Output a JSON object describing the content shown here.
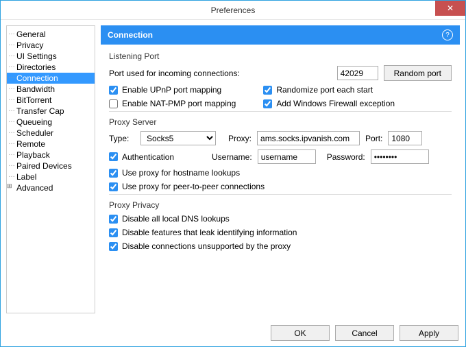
{
  "window": {
    "title": "Preferences"
  },
  "tree": {
    "items": [
      "General",
      "Privacy",
      "UI Settings",
      "Directories",
      "Connection",
      "Bandwidth",
      "BitTorrent",
      "Transfer Cap",
      "Queueing",
      "Scheduler",
      "Remote",
      "Playback",
      "Paired Devices",
      "Label",
      "Advanced"
    ],
    "selected": "Connection",
    "expandable": [
      "Advanced"
    ]
  },
  "header": {
    "title": "Connection"
  },
  "listening": {
    "group": "Listening Port",
    "port_label": "Port used for incoming connections:",
    "port_value": "42029",
    "random_btn": "Random port",
    "upnp": "Enable UPnP port mapping",
    "upnp_checked": true,
    "natpmp": "Enable NAT-PMP port mapping",
    "natpmp_checked": false,
    "randomize": "Randomize port each start",
    "randomize_checked": true,
    "firewall": "Add Windows Firewall exception",
    "firewall_checked": true
  },
  "proxy": {
    "group": "Proxy Server",
    "type_label": "Type:",
    "type_value": "Socks5",
    "proxy_label": "Proxy:",
    "proxy_value": "ams.socks.ipvanish.com",
    "port_label": "Port:",
    "port_value": "1080",
    "auth": "Authentication",
    "auth_checked": true,
    "user_label": "Username:",
    "user_value": "username",
    "pass_label": "Password:",
    "pass_value": "••••••••",
    "hostname": "Use proxy for hostname lookups",
    "hostname_checked": true,
    "p2p": "Use proxy for peer-to-peer connections",
    "p2p_checked": true
  },
  "privacy": {
    "group": "Proxy Privacy",
    "dns": "Disable all local DNS lookups",
    "dns_checked": true,
    "leak": "Disable features that leak identifying information",
    "leak_checked": true,
    "unsupported": "Disable connections unsupported by the proxy",
    "unsupported_checked": true
  },
  "buttons": {
    "ok": "OK",
    "cancel": "Cancel",
    "apply": "Apply"
  }
}
